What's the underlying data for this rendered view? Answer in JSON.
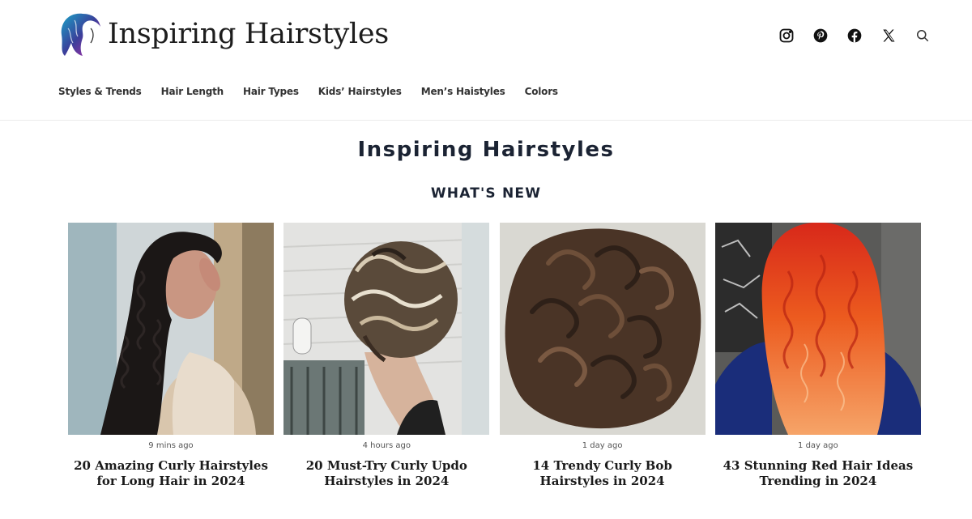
{
  "header": {
    "logo_text": "Inspiring Hairstyles",
    "social_icons": [
      "instagram-icon",
      "pinterest-icon",
      "facebook-icon",
      "x-icon",
      "search-icon"
    ]
  },
  "nav": {
    "items": [
      "Styles & Trends",
      "Hair Length",
      "Hair Types",
      "Kids’ Hairstyles",
      "Men’s Haistyles",
      "Colors"
    ]
  },
  "main": {
    "site_title": "Inspiring Hairstyles",
    "section_title": "WHAT'S NEW",
    "posts": [
      {
        "time": "9 mins ago",
        "title": "20 Amazing Curly Hairstyles for Long Hair in 2024"
      },
      {
        "time": "4 hours ago",
        "title": "20 Must-Try Curly Updo Hairstyles in 2024"
      },
      {
        "time": "1 day ago",
        "title": "14 Trendy Curly Bob Hairstyles in 2024"
      },
      {
        "time": "1 day ago",
        "title": "43 Stunning Red Hair Ideas Trending in 2024"
      }
    ]
  },
  "colors": {
    "title_navy": "#1b2333",
    "text_dark": "#1b1b1b"
  }
}
